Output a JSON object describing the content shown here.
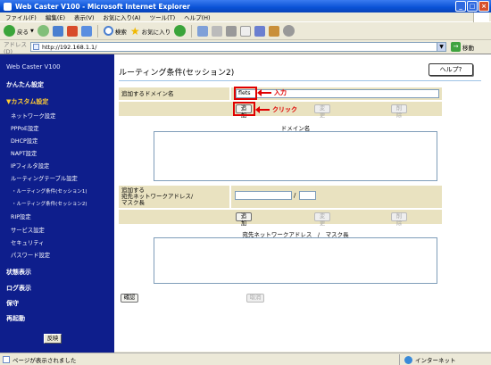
{
  "window": {
    "title": "Web Caster V100 - Microsoft Internet Explorer"
  },
  "menu": [
    "ファイル(F)",
    "編集(E)",
    "表示(V)",
    "お気に入り(A)",
    "ツール(T)",
    "ヘルプ(H)"
  ],
  "toolbar": {
    "back": "戻る",
    "search": "検索",
    "favorites": "お気に入り"
  },
  "address": {
    "label": "アドレス(D)",
    "url": "http://192.168.1.1/",
    "go": "移動"
  },
  "sidebar": {
    "title": "Web Caster V100",
    "easy_setup": "かんたん設定",
    "custom_setup": "▼カスタム設定",
    "items": [
      "ネットワーク設定",
      "PPPoE設定",
      "DHCP設定",
      "NAPT設定",
      "IPフィルタ設定",
      "ルーティングテーブル設定",
      "・ルーティング条件(セッション1)",
      "・ルーティング条件(セッション2)",
      "RIP設定",
      "サービス設定",
      "セキュリティ",
      "パスワード設定"
    ],
    "status": "状態表示",
    "log": "ログ表示",
    "maintenance": "保守",
    "restart": "再起動",
    "apply": "反映"
  },
  "main": {
    "title": "ルーティング条件(セッション2)",
    "help": "ヘルプ?",
    "domain_label": "追加するドメイン名",
    "domain_value": "flets",
    "annot_input": "入力",
    "annot_click": "クリック",
    "add": "追加",
    "change": "変更",
    "delete": "削除",
    "domain_list_label": "ドメイン名",
    "network_label_1": "追加する",
    "network_label_2": "宛先ネットワークアドレス/",
    "network_label_3": "マスク長",
    "slash": "/",
    "network_list_label": "宛先ネットワークアドレス　/　マスク長",
    "confirm": "確認",
    "cancel": "取消"
  },
  "status": {
    "text": "ページが表示されました",
    "zone": "インターネット"
  },
  "colors": {
    "sidebar": "#0e1e8c",
    "annotation": "#e00000",
    "row": "#e9e2c0"
  }
}
